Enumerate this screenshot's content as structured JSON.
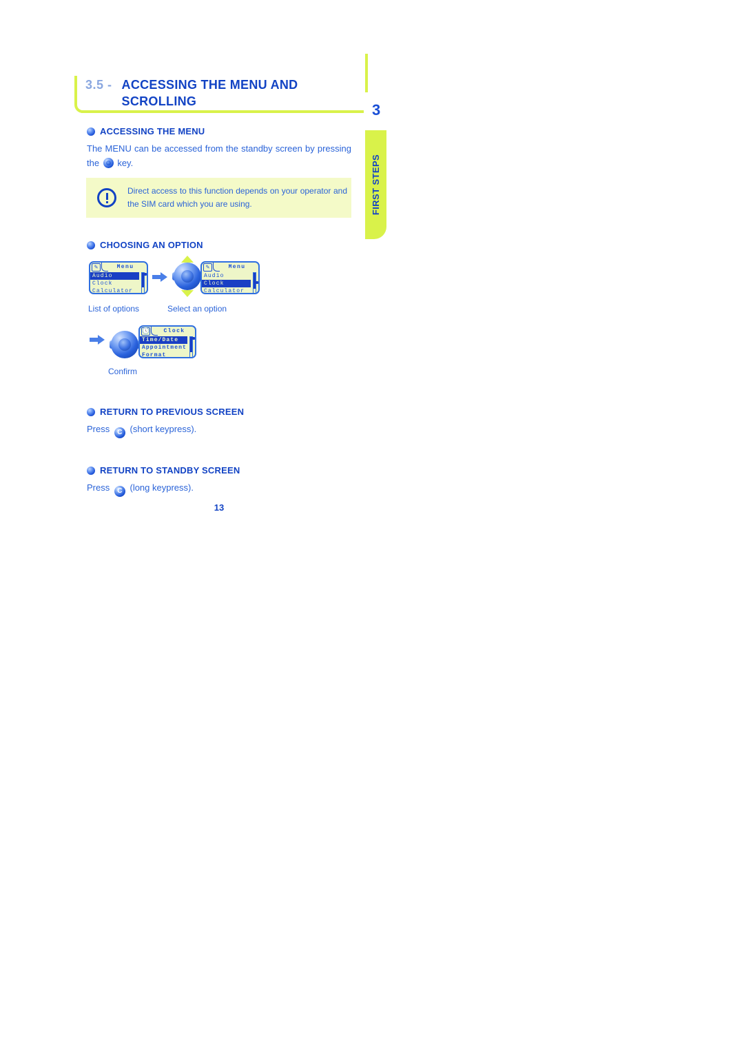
{
  "side_tab": {
    "chapter_number": "3",
    "label": "FIRST STEPS",
    "color": "#d9f24a",
    "text_color": "#1243c4"
  },
  "heading": {
    "number": "3.5 -",
    "title": "ACCESSING THE MENU AND SCROLLING",
    "accent_color": "#d9f24a",
    "title_color": "#1243c4",
    "number_color": "#8aa7e0"
  },
  "sections": [
    {
      "id": "accessing-the-menu",
      "heading": "ACCESSING THE MENU",
      "body_before_icon": "The MENU can be accessed from the standby screen by pressing the",
      "icon": "round-key-icon",
      "body_after_icon": "key."
    },
    {
      "id": "choosing-an-option",
      "heading": "CHOOSING AN OPTION"
    },
    {
      "id": "return-to-previous-screen",
      "heading": "RETURN TO PREVIOUS SCREEN",
      "body_before_icon": "Press",
      "icon_label": "C",
      "body_after_icon": "(short keypress)."
    },
    {
      "id": "return-to-standby-screen",
      "heading": "RETURN TO STANDBY SCREEN",
      "body_before_icon": "Press",
      "icon_label": "C",
      "body_after_icon": "(long keypress)."
    }
  ],
  "note": {
    "icon": "exclamation-circle-icon",
    "text": "Direct access to this function depends on your operator and the SIM card which you are using.",
    "background": "#f4fac8",
    "text_color": "#2a63d8"
  },
  "screens": [
    {
      "id": "screen-menu-audio",
      "tab_icon": "pencil-icon",
      "title": "Menu",
      "rows": [
        {
          "label": "Audio",
          "selected": true
        },
        {
          "label": "Clock",
          "selected": false
        },
        {
          "label": "Calculator",
          "selected": false
        }
      ],
      "scroll_position": "top",
      "caption": "List of options"
    },
    {
      "id": "screen-menu-clock",
      "tab_icon": "pencil-icon",
      "title": "Menu",
      "rows": [
        {
          "label": "Audio",
          "selected": false
        },
        {
          "label": "Clock",
          "selected": true
        },
        {
          "label": "Calculator",
          "selected": false
        }
      ],
      "scroll_position": "middle",
      "caption": "Select an option"
    },
    {
      "id": "screen-clock-timedate",
      "tab_icon": "clock-icon",
      "title": "Clock",
      "rows": [
        {
          "label": "Time/Date",
          "selected": true
        },
        {
          "label": "Appointment",
          "selected": false
        },
        {
          "label": "Format",
          "selected": false
        }
      ],
      "scroll_position": "top",
      "caption": "Confirm"
    }
  ],
  "navpad": {
    "id": "navigation-pad",
    "up_icon": "triangle-up-icon",
    "down_icon": "triangle-down-icon",
    "center_icon": "ok-key-icon"
  },
  "captions": {
    "list_of_options": "List of options",
    "select_an_option": "Select an option",
    "confirm": "Confirm"
  },
  "page_number": "13",
  "colors": {
    "accent_lime": "#d9f24a",
    "brand_blue": "#1243c4",
    "body_blue": "#2a63d8",
    "lcd_background": "#eef6c8",
    "lcd_select": "#1a3fc4"
  }
}
